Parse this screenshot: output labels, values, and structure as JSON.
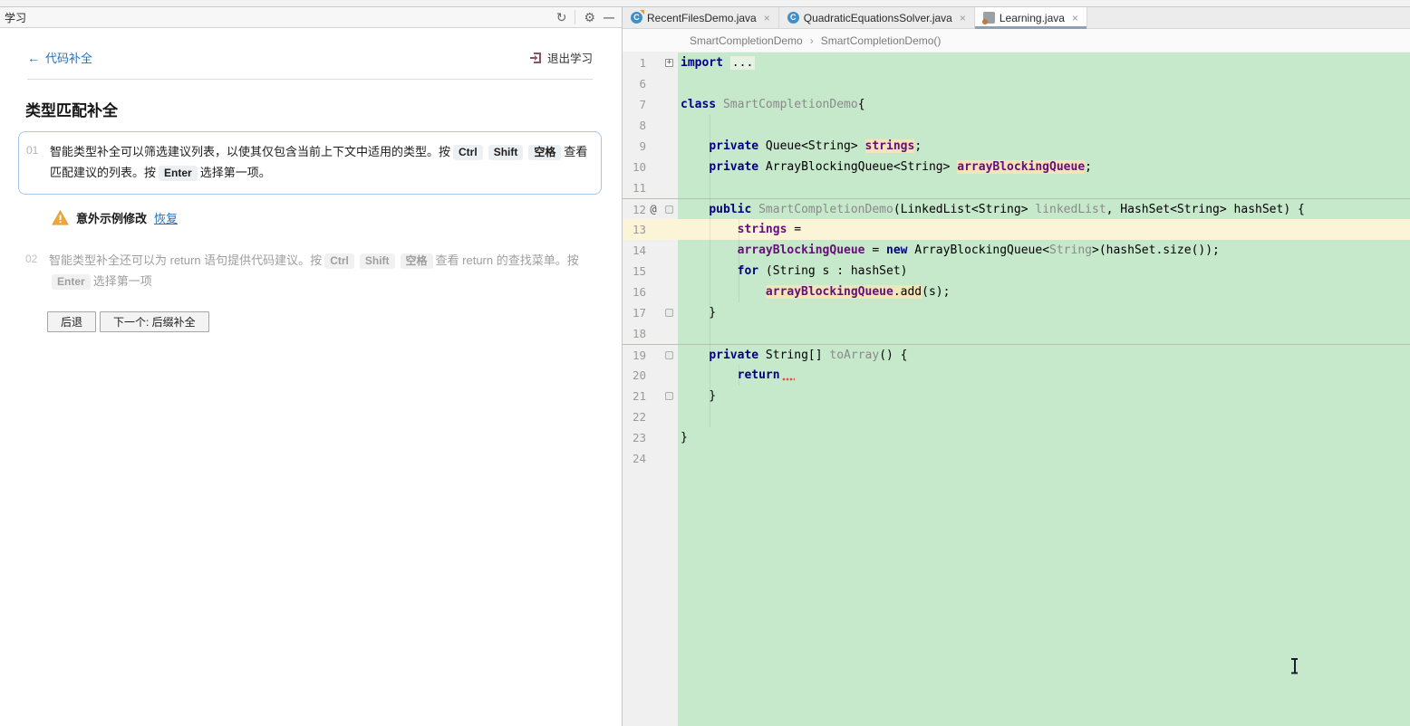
{
  "learn_panel": {
    "title": "学习",
    "back_label": "代码补全",
    "exit_label": "退出学习",
    "lesson_title": "类型匹配补全",
    "steps": [
      {
        "number": "01",
        "text_before_keys": "智能类型补全可以筛选建议列表，以使其仅包含当前上下文中适用的类型。按",
        "keys": [
          "Ctrl",
          "Shift",
          "空格"
        ],
        "text_mid": "查看匹配建议的列表。按",
        "enter_key": "Enter",
        "text_after": "选择第一项。"
      },
      {
        "number": "02",
        "text_before_keys": "智能类型补全还可以为 return 语句提供代码建议。按",
        "keys": [
          "Ctrl",
          "Shift",
          "空格"
        ],
        "text_mid": "查看 return 的查找菜单。按",
        "enter_key": "Enter",
        "text_after": "选择第一项"
      }
    ],
    "warning": {
      "label": "意外示例修改",
      "restore_link": "恢复"
    },
    "buttons": {
      "back": "后退",
      "next": "下一个: 后缀补全"
    }
  },
  "editor": {
    "tabs": [
      {
        "label": "RecentFilesDemo.java"
      },
      {
        "label": "QuadraticEquationsSolver.java"
      },
      {
        "label": "Learning.java"
      }
    ],
    "breadcrumbs": {
      "items": [
        "SmartCompletionDemo",
        "SmartCompletionDemo()"
      ]
    },
    "code": {
      "lines": [
        {
          "n": "1",
          "fold": "plus",
          "tk": [
            [
              "import",
              "k"
            ],
            [
              " ",
              ""
            ],
            [
              "...",
              "fold"
            ]
          ]
        },
        {
          "n": "6",
          "tk": []
        },
        {
          "n": "7",
          "tk": [
            [
              "class",
              "k"
            ],
            [
              " ",
              ""
            ],
            [
              "SmartCompletionDemo",
              "g"
            ],
            [
              "{",
              ""
            ]
          ]
        },
        {
          "n": "8",
          "tk": []
        },
        {
          "n": "9",
          "tk": [
            [
              "    ",
              ""
            ],
            [
              "private",
              "k"
            ],
            [
              " Queue<String> ",
              ""
            ],
            [
              "strings",
              "f hl"
            ],
            [
              ";",
              ""
            ]
          ]
        },
        {
          "n": "10",
          "tk": [
            [
              "    ",
              ""
            ],
            [
              "private",
              "k"
            ],
            [
              " ArrayBlockingQueue<String> ",
              ""
            ],
            [
              "arrayBlockingQueue",
              "f hl"
            ],
            [
              ";",
              ""
            ]
          ]
        },
        {
          "n": "11",
          "tk": []
        },
        {
          "n": "12",
          "anno": "@",
          "fold": "open",
          "sep": true,
          "tk": [
            [
              "    ",
              ""
            ],
            [
              "public",
              "k"
            ],
            [
              " ",
              ""
            ],
            [
              "SmartCompletionDemo",
              "g"
            ],
            [
              "(LinkedList<String> ",
              ""
            ],
            [
              "linkedList",
              "g"
            ],
            [
              ", HashSet<String> hashSet) {",
              ""
            ]
          ]
        },
        {
          "n": "13",
          "cur": true,
          "tk": [
            [
              "        ",
              ""
            ],
            [
              "strings",
              "f"
            ],
            [
              " = ",
              ""
            ]
          ]
        },
        {
          "n": "14",
          "tk": [
            [
              "        ",
              ""
            ],
            [
              "arrayBlockingQueue",
              "f"
            ],
            [
              " = ",
              ""
            ],
            [
              "new",
              "k"
            ],
            [
              " ArrayBlockingQueue<",
              ""
            ],
            [
              "String",
              "g"
            ],
            [
              ">(hashSet.size());",
              ""
            ]
          ]
        },
        {
          "n": "15",
          "tk": [
            [
              "        ",
              ""
            ],
            [
              "for",
              "k"
            ],
            [
              " (String s : hashSet)",
              ""
            ]
          ]
        },
        {
          "n": "16",
          "tk": [
            [
              "            ",
              ""
            ],
            [
              "arrayBlockingQueue",
              "f hl"
            ],
            [
              ".add",
              "hl"
            ],
            [
              "(s);",
              ""
            ]
          ]
        },
        {
          "n": "17",
          "fold": "end",
          "tk": [
            [
              "    }",
              ""
            ]
          ]
        },
        {
          "n": "18",
          "tk": []
        },
        {
          "n": "19",
          "fold": "open",
          "sep": true,
          "tk": [
            [
              "    ",
              ""
            ],
            [
              "private",
              "k"
            ],
            [
              " String[] ",
              ""
            ],
            [
              "toArray",
              "g"
            ],
            [
              "() {",
              ""
            ]
          ]
        },
        {
          "n": "20",
          "tk": [
            [
              "        ",
              ""
            ],
            [
              "return",
              "k"
            ],
            [
              "",
              "sq"
            ]
          ]
        },
        {
          "n": "21",
          "fold": "end",
          "tk": [
            [
              "    }",
              ""
            ]
          ]
        },
        {
          "n": "22",
          "tk": []
        },
        {
          "n": "23",
          "tk": [
            [
              "}",
              ""
            ]
          ]
        },
        {
          "n": "24",
          "tk": []
        }
      ]
    }
  },
  "glyphs": {
    "back_arrow": "←",
    "restart_icon": "↻",
    "settings_icon": "⚙",
    "minimize_icon": "—",
    "tab_close": "×",
    "breadcrumb_separator": "›",
    "class_icon_letter": "C",
    "warning_mark": "!",
    "fold_plus": "+"
  },
  "colors": {
    "editor_background": "#c6e8cb",
    "current_line": "#fbf4d7",
    "identifier_highlight": "#f2e5ba",
    "keyword": "#000080",
    "field_name": "#660e7a",
    "active_tab_underline": "#90a1b3",
    "link_blue": "#2673bd",
    "warning_orange": "#f1a63b"
  }
}
